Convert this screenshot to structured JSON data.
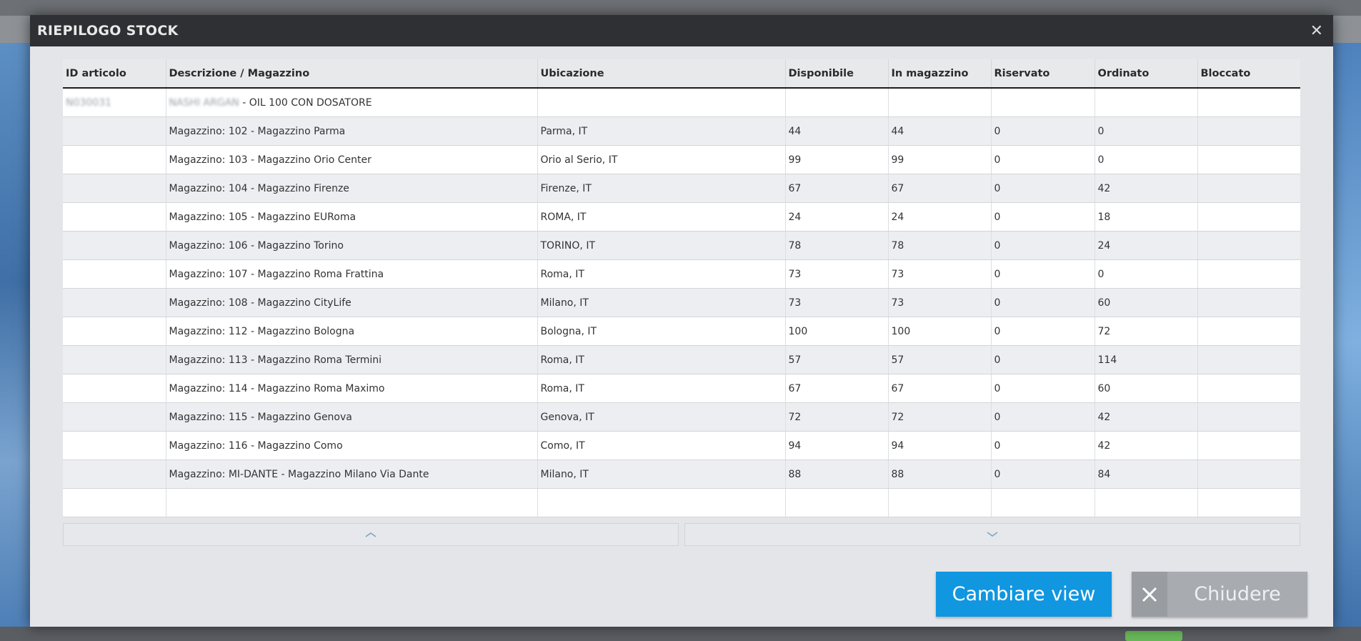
{
  "dialog": {
    "title": "RIEPILOGO STOCK",
    "close_glyph": "✕"
  },
  "table": {
    "columns": [
      "ID articolo",
      "Descrizione / Magazzino",
      "Ubicazione",
      "Disponibile",
      "In magazzino",
      "Riservato",
      "Ordinato",
      "Bloccato"
    ],
    "article": {
      "id": "N030031",
      "name": "NASHI ARGAN",
      "description_suffix": " - OIL 100 CON DOSATORE"
    },
    "rows": [
      {
        "desc": "Magazzino: 102 - Magazzino Parma",
        "loc": "Parma, IT",
        "disp": "44",
        "mag": "44",
        "ris": "0",
        "ord": "0",
        "blo": ""
      },
      {
        "desc": "Magazzino: 103 - Magazzino Orio Center",
        "loc": "Orio al Serio, IT",
        "disp": "99",
        "mag": "99",
        "ris": "0",
        "ord": "0",
        "blo": ""
      },
      {
        "desc": "Magazzino: 104 - Magazzino Firenze",
        "loc": "Firenze, IT",
        "disp": "67",
        "mag": "67",
        "ris": "0",
        "ord": "42",
        "blo": ""
      },
      {
        "desc": "Magazzino: 105 - Magazzino EURoma",
        "loc": "ROMA, IT",
        "disp": "24",
        "mag": "24",
        "ris": "0",
        "ord": "18",
        "blo": ""
      },
      {
        "desc": "Magazzino: 106 - Magazzino Torino",
        "loc": "TORINO, IT",
        "disp": "78",
        "mag": "78",
        "ris": "0",
        "ord": "24",
        "blo": ""
      },
      {
        "desc": "Magazzino: 107 - Magazzino Roma Frattina",
        "loc": "Roma, IT",
        "disp": "73",
        "mag": "73",
        "ris": "0",
        "ord": "0",
        "blo": ""
      },
      {
        "desc": "Magazzino: 108 - Magazzino CityLife",
        "loc": "Milano, IT",
        "disp": "73",
        "mag": "73",
        "ris": "0",
        "ord": "60",
        "blo": ""
      },
      {
        "desc": "Magazzino: 112 - Magazzino Bologna",
        "loc": "Bologna, IT",
        "disp": "100",
        "mag": "100",
        "ris": "0",
        "ord": "72",
        "blo": ""
      },
      {
        "desc": "Magazzino: 113 - Magazzino Roma Termini",
        "loc": "Roma, IT",
        "disp": "57",
        "mag": "57",
        "ris": "0",
        "ord": "114",
        "blo": ""
      },
      {
        "desc": "Magazzino: 114 - Magazzino Roma Maximo",
        "loc": "Roma, IT",
        "disp": "67",
        "mag": "67",
        "ris": "0",
        "ord": "60",
        "blo": ""
      },
      {
        "desc": "Magazzino: 115 - Magazzino Genova",
        "loc": "Genova, IT",
        "disp": "72",
        "mag": "72",
        "ris": "0",
        "ord": "42",
        "blo": ""
      },
      {
        "desc": "Magazzino: 116 - Magazzino Como",
        "loc": "Como, IT",
        "disp": "94",
        "mag": "94",
        "ris": "0",
        "ord": "42",
        "blo": ""
      },
      {
        "desc": "Magazzino: MI-DANTE - Magazzino Milano Via Dante",
        "loc": "Milano, IT",
        "disp": "88",
        "mag": "88",
        "ris": "0",
        "ord": "84",
        "blo": ""
      }
    ]
  },
  "scroll": {
    "up_icon": "chevron-up-icon",
    "down_icon": "chevron-down-icon"
  },
  "buttons": {
    "change_view": "Cambiare view",
    "close": "Chiudere",
    "close_icon": "close-icon"
  },
  "colors": {
    "primary": "#1196e0",
    "header": "#2f3033",
    "secondary_button": "#a8abb0"
  }
}
